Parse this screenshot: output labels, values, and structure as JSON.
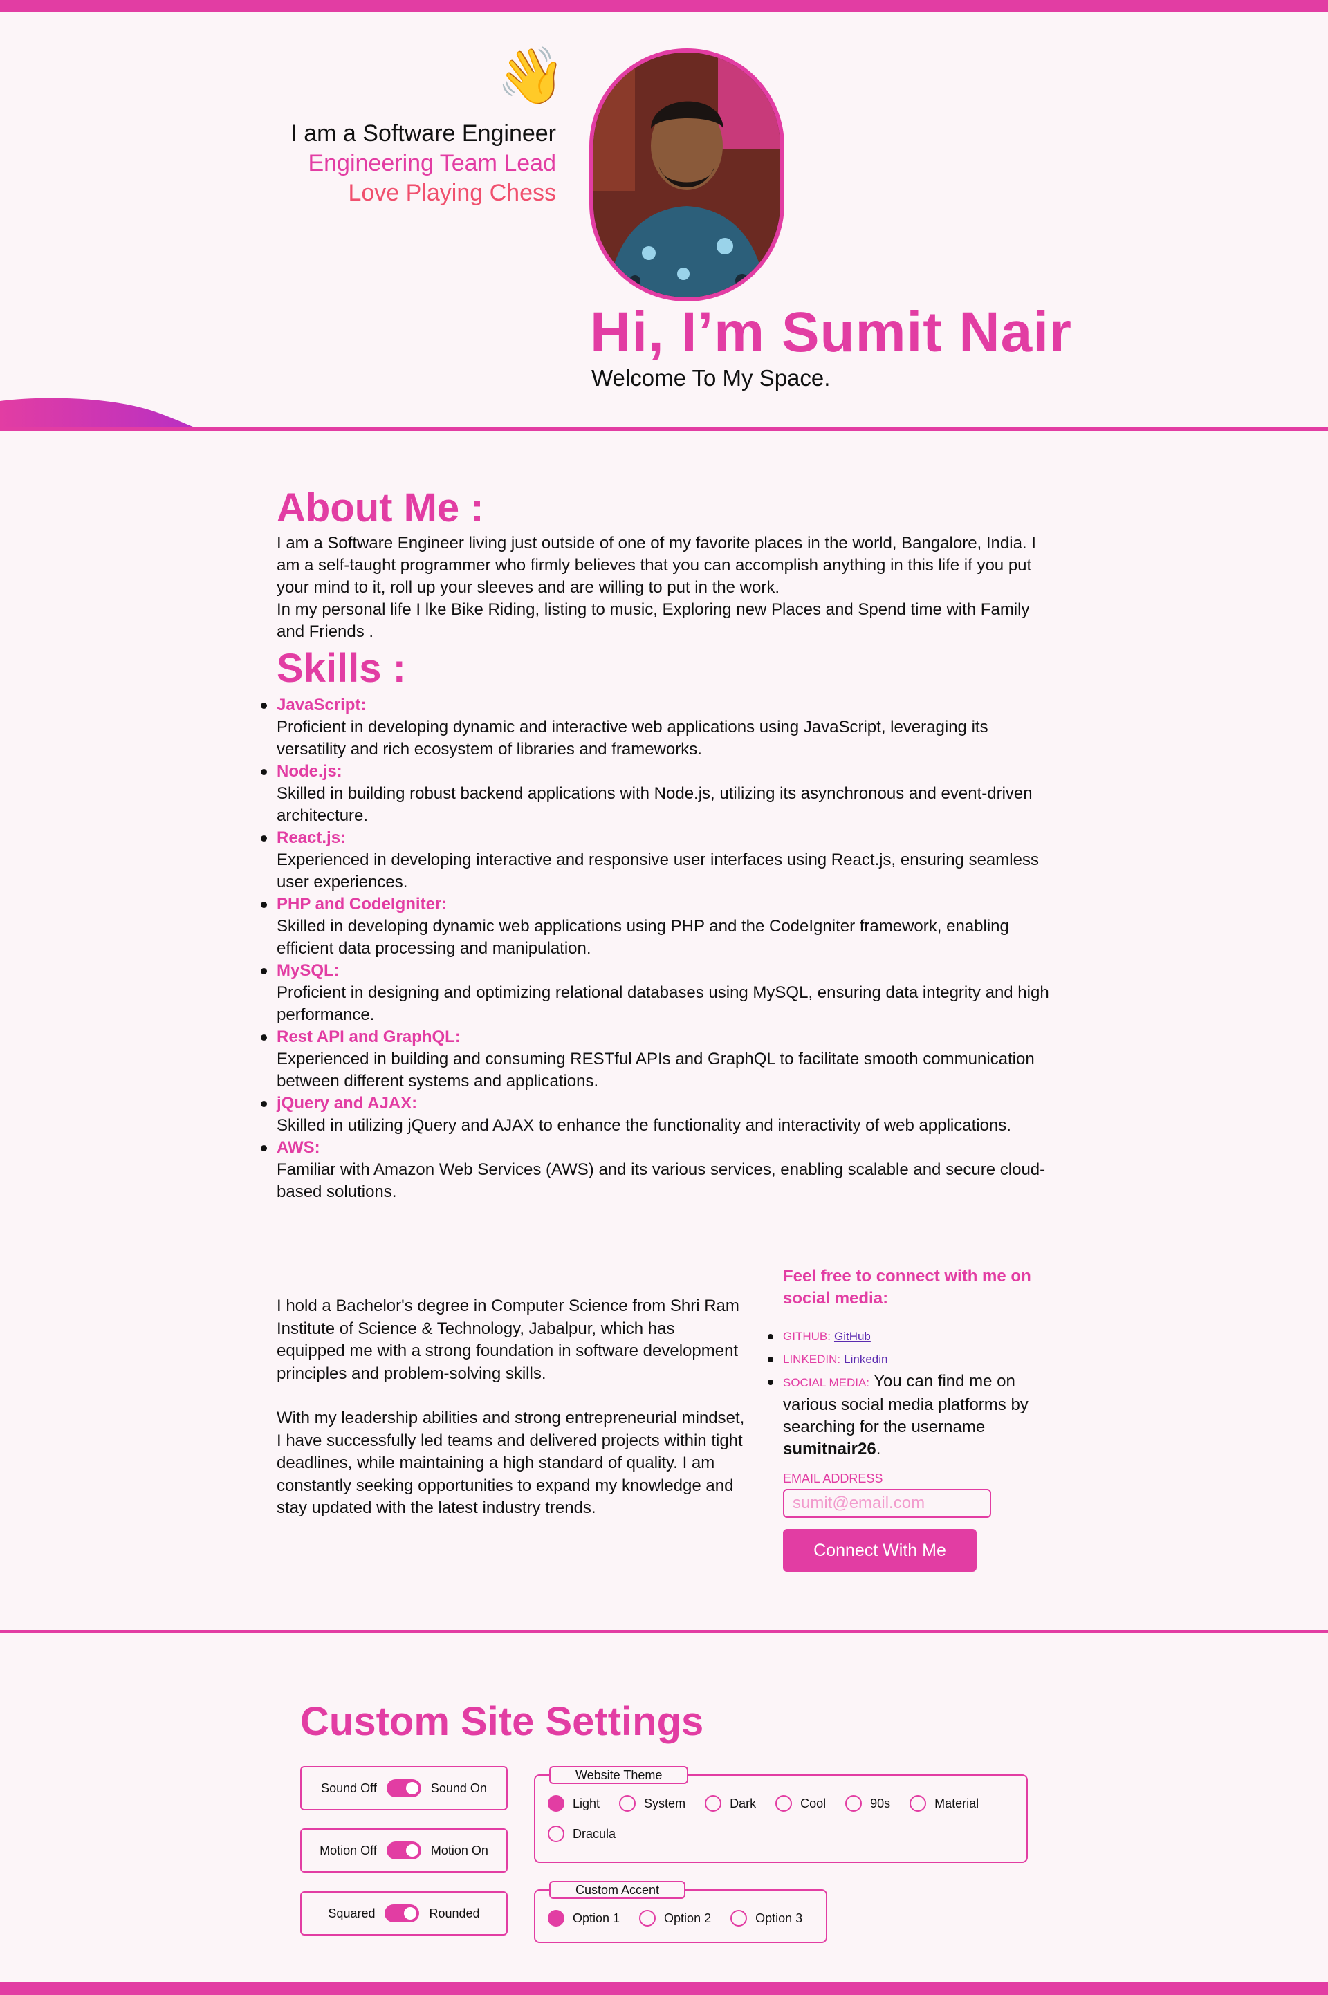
{
  "colors": {
    "accent": "#e23da3",
    "chess": "#f0506e",
    "background": "#fcf5f8",
    "link": "#5b2bb0"
  },
  "hero": {
    "wave_icon": "👋",
    "intro_line1": "I am a Software Engineer",
    "intro_line2": "Engineering Team Lead",
    "intro_line3": "Love Playing Chess",
    "name": "Hi, I’m Sumit Nair",
    "subtitle": "Welcome To My Space."
  },
  "about": {
    "heading": "About Me :",
    "text1": "I am a Software Engineer living just outside of one of my favorite places in the world, Bangalore, India. I am a self-taught programmer who firmly believes that you can accomplish anything in this life if you put your mind to it, roll up your sleeves and are willing to put in the work.",
    "text2": "In my personal life I lke Bike Riding, listing to music, Exploring new Places and Spend time with Family and Friends ."
  },
  "skills": {
    "heading": "Skills :",
    "items": [
      {
        "name": "JavaScript:",
        "desc": "Proficient in developing dynamic and interactive web applications using JavaScript, leveraging its versatility and rich ecosystem of libraries and frameworks."
      },
      {
        "name": "Node.js:",
        "desc": "Skilled in building robust backend applications with Node.js, utilizing its asynchronous and event-driven architecture."
      },
      {
        "name": "React.js:",
        "desc": "Experienced in developing interactive and responsive user interfaces using React.js, ensuring seamless user experiences."
      },
      {
        "name": "PHP and CodeIgniter:",
        "desc": "Skilled in developing dynamic web applications using PHP and the CodeIgniter framework, enabling efficient data processing and manipulation."
      },
      {
        "name": "MySQL:",
        "desc": "Proficient in designing and optimizing relational databases using MySQL, ensuring data integrity and high performance."
      },
      {
        "name": "Rest API and GraphQL:",
        "desc": "Experienced in building and consuming RESTful APIs and GraphQL to facilitate smooth communication between different systems and applications."
      },
      {
        "name": "jQuery and AJAX:",
        "desc": "Skilled in utilizing jQuery and AJAX to enhance the functionality and interactivity of web applications."
      },
      {
        "name": "AWS:",
        "desc": "Familiar with Amazon Web Services (AWS) and its various services, enabling scalable and secure cloud-based solutions."
      }
    ]
  },
  "bio": {
    "p1": "I hold a Bachelor's degree in Computer Science from Shri Ram Institute of Science & Technology, Jabalpur, which has equipped me with a strong foundation in software development principles and problem-solving skills.",
    "p2": "With my leadership abilities and strong entrepreneurial mindset, I have successfully led teams and delivered projects within tight deadlines, while maintaining a high standard of quality. I am constantly seeking opportunities to expand my knowledge and stay updated with the latest industry trends."
  },
  "connect": {
    "title": "Feel free to connect with me on social media:",
    "github_label": "GITHUB:",
    "github_link": "GitHub",
    "linkedin_label": "LINKEDIN:",
    "linkedin_link": "Linkedin",
    "social_label": "SOCIAL MEDIA:",
    "social_text": "You can find me on various social media platforms by searching for the username",
    "username": "sumitnair26",
    "period": ".",
    "email_label": "EMAIL ADDRESS",
    "email_placeholder": "sumit@email.com",
    "button": "Connect With Me"
  },
  "settings": {
    "title": "Custom Site Settings",
    "sound": {
      "off": "Sound Off",
      "on": "Sound On",
      "state": "on"
    },
    "motion": {
      "off": "Motion Off",
      "on": "Motion On",
      "state": "on"
    },
    "corners": {
      "off": "Squared",
      "on": "Rounded",
      "state": "on"
    },
    "theme": {
      "legend": "Website Theme",
      "options": [
        "Light",
        "System",
        "Dark",
        "Cool",
        "90s",
        "Material",
        "Dracula"
      ],
      "selected": "Light"
    },
    "accent": {
      "legend": "Custom Accent",
      "options": [
        "Option 1",
        "Option 2",
        "Option 3"
      ],
      "selected": "Option 1"
    }
  }
}
